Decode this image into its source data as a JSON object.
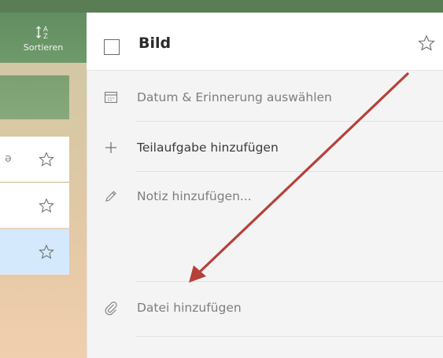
{
  "left_panel": {
    "sort_label": "Sortieren",
    "sort_icon": "sort-alpha-icon",
    "row_fragment": "ə",
    "rows": [
      {
        "starred": false
      },
      {
        "starred": false
      },
      {
        "starred": false,
        "selected": true
      }
    ]
  },
  "detail": {
    "title": "Bild",
    "completed": false,
    "starred": false,
    "date_label": "Datum & Erinnerung auswählen",
    "subtask_label": "Teilaufgabe hinzufügen",
    "note_label": "Notiz hinzufügen...",
    "file_label": "Datei hinzufügen"
  },
  "colors": {
    "accent_green": "#5f8a5e",
    "selected_row": "#d4e9fb",
    "annotation_arrow": "#b5413a",
    "muted_text": "#7d7d7d",
    "dark_text": "#3a3a3a"
  }
}
